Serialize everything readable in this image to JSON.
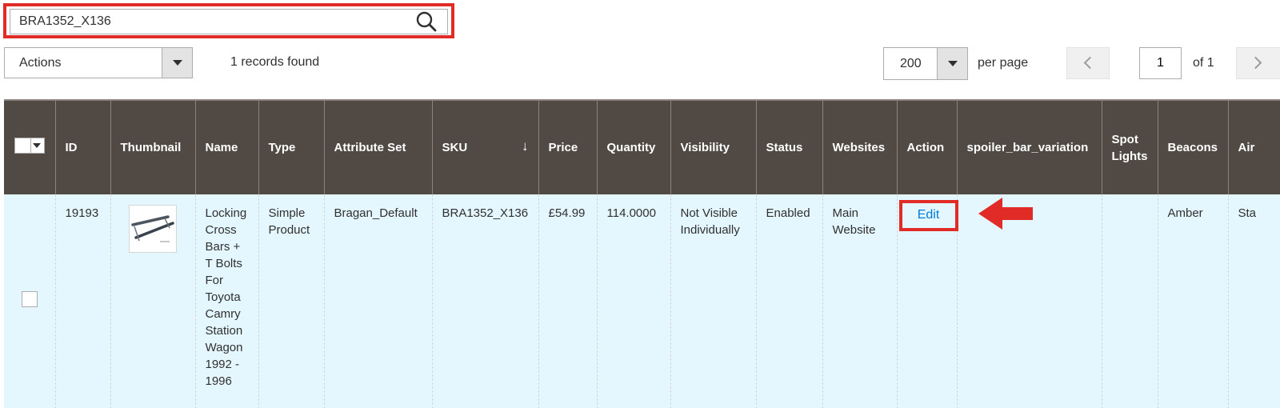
{
  "search": {
    "value": "BRA1352_X136"
  },
  "toolbar": {
    "actions_label": "Actions",
    "records_found": "1 records found",
    "per_page_value": "200",
    "per_page_label": "per page",
    "current_page": "1",
    "total_pages_label": "of 1"
  },
  "grid": {
    "columns": [
      "ID",
      "Thumbnail",
      "Name",
      "Type",
      "Attribute Set",
      "SKU",
      "Price",
      "Quantity",
      "Visibility",
      "Status",
      "Websites",
      "Action",
      "spoiler_bar_variation",
      "Spot Lights",
      "Beacons",
      "Air"
    ],
    "sort_indicator": "↓",
    "rows": [
      {
        "id": "19193",
        "name": "Locking Cross Bars + T Bolts For Toyota Camry Station Wagon 1992 - 1996",
        "type": "Simple Product",
        "attribute_set": "Bragan_Default",
        "sku": "BRA1352_X136",
        "price": "£54.99",
        "quantity": "114.0000",
        "visibility": "Not Visible Individually",
        "status": "Enabled",
        "websites": "Main Website",
        "action": "Edit",
        "spoiler_bar_variation": "",
        "spot_lights": "",
        "beacons": "Amber",
        "air": "Sta"
      }
    ]
  },
  "colors": {
    "header_bg": "#514943",
    "row_bg": "#e5f7fe",
    "highlight_red": "#e02b27",
    "link_blue": "#007bdb"
  }
}
